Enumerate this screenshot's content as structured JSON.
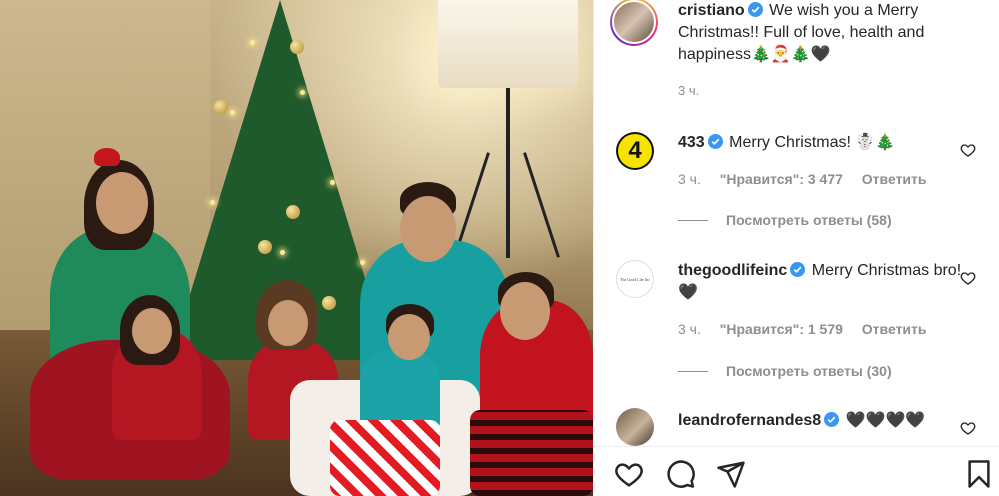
{
  "post": {
    "author": "cristiano",
    "caption": "We wish you a Merry Christmas!! Full of love, health and happiness🎄🎅🎄🖤",
    "time": "3 ч.",
    "photo_alt": ""
  },
  "comments": [
    {
      "username": "433",
      "verified": true,
      "text": "Merry Christmas! ☃️🎄",
      "time": "3 ч.",
      "likes": "\"Нравится\": 3 477",
      "reply_label": "Ответить",
      "view_replies": "Посмотреть ответы (58)"
    },
    {
      "username": "thegoodlifeinc",
      "verified": true,
      "text": "Merry Christmas bro! 🖤",
      "time": "3 ч.",
      "likes": "\"Нравится\": 1 579",
      "reply_label": "Ответить",
      "view_replies": "Посмотреть ответы (30)"
    },
    {
      "username": "leandrofernandes8",
      "verified": true,
      "text": "🖤🖤🖤🖤"
    }
  ],
  "avatars": {
    "tgl_text": "The Good Life Inc"
  },
  "icons": {
    "like": "heart-icon",
    "comment": "comment-icon",
    "share": "share-icon",
    "save": "bookmark-icon",
    "verified": "verified-badge-icon",
    "comment_like": "heart-icon"
  },
  "colors": {
    "verified": "#3897f0",
    "text": "#262626",
    "secondary": "#8e8e8e"
  }
}
